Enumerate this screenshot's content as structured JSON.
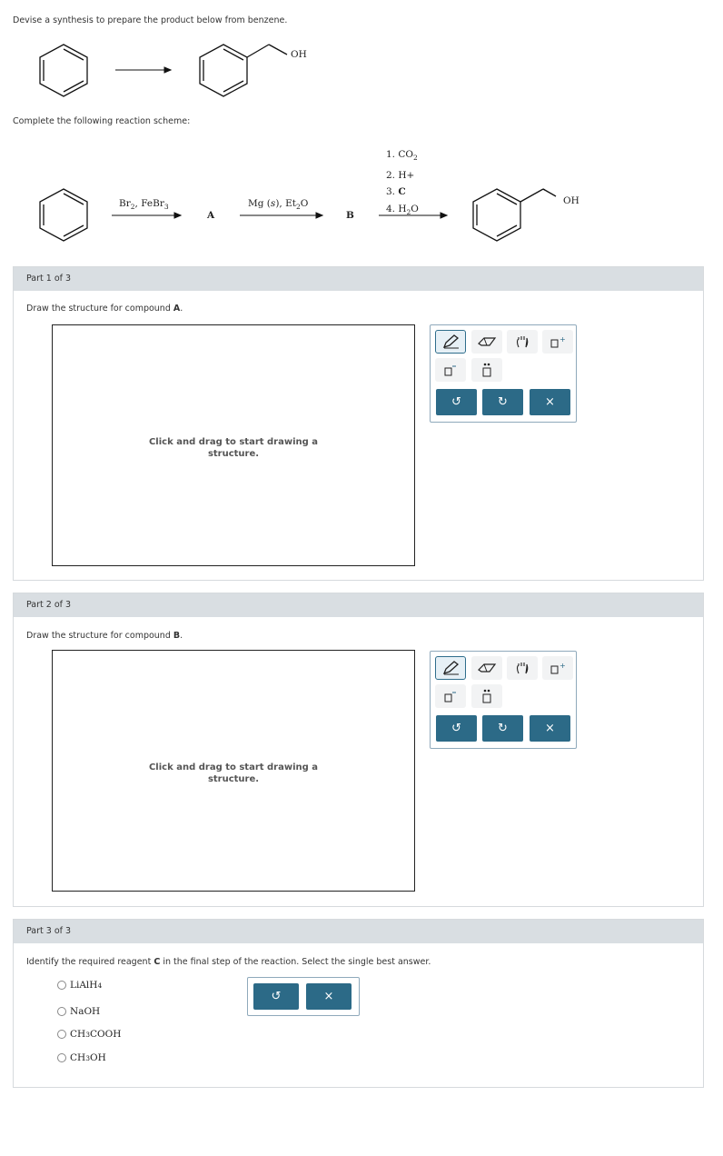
{
  "question": {
    "prompt": "Devise a synthesis to prepare the product below from benzene.",
    "product_label": "OH",
    "scheme_label": "Complete the following reaction scheme:"
  },
  "scheme": {
    "reagent1": "Br",
    "reagent1_sub": "2",
    "reagent1_b": ", FeBr",
    "reagent1_sub2": "3",
    "compound_a": "A",
    "reagent2": "Mg (",
    "reagent2_italic": "s",
    "reagent2_b": "), Et",
    "reagent2_sub": "2",
    "reagent2_c": "O",
    "compound_b": "B",
    "step1": "1. CO",
    "step1_sub": "2",
    "step2": "2. H+",
    "step3": "3. ",
    "step3_bold": "C",
    "step4": "4. H",
    "step4_sub": "2",
    "step4_b": "O",
    "product_label": "OH"
  },
  "parts": [
    {
      "header": "Part 1 of 3",
      "instruction_pre": "Draw the structure for compound ",
      "instruction_bold": "A",
      "instruction_post": ".",
      "canvas_hint": "Click and drag to start drawing a structure."
    },
    {
      "header": "Part 2 of 3",
      "instruction_pre": "Draw the structure for compound ",
      "instruction_bold": "B",
      "instruction_post": ".",
      "canvas_hint": "Click and drag to start drawing a structure."
    },
    {
      "header": "Part 3 of 3",
      "instruction_pre": "Identify the required reagent ",
      "instruction_bold": "C",
      "instruction_post": " in the final step of the reaction. Select the single best answer.",
      "options": [
        {
          "main": "LiAlH",
          "sub": "4",
          "tail": ""
        },
        {
          "main": "NaOH",
          "sub": "",
          "tail": ""
        },
        {
          "main": "CH",
          "sub": "3",
          "tail": "COOH"
        },
        {
          "main": "CH",
          "sub": "3",
          "tail": "OH"
        }
      ]
    }
  ],
  "toolbar": {
    "tools": [
      "pencil-icon",
      "eraser-icon",
      "hand-icon",
      "template-icon",
      "charge-icon",
      "lone-pair-icon"
    ],
    "undo": "↺",
    "redo": "↻",
    "clear": "×"
  },
  "colors": {
    "accent": "#2c6a87",
    "part_header": "#d9dee2"
  }
}
